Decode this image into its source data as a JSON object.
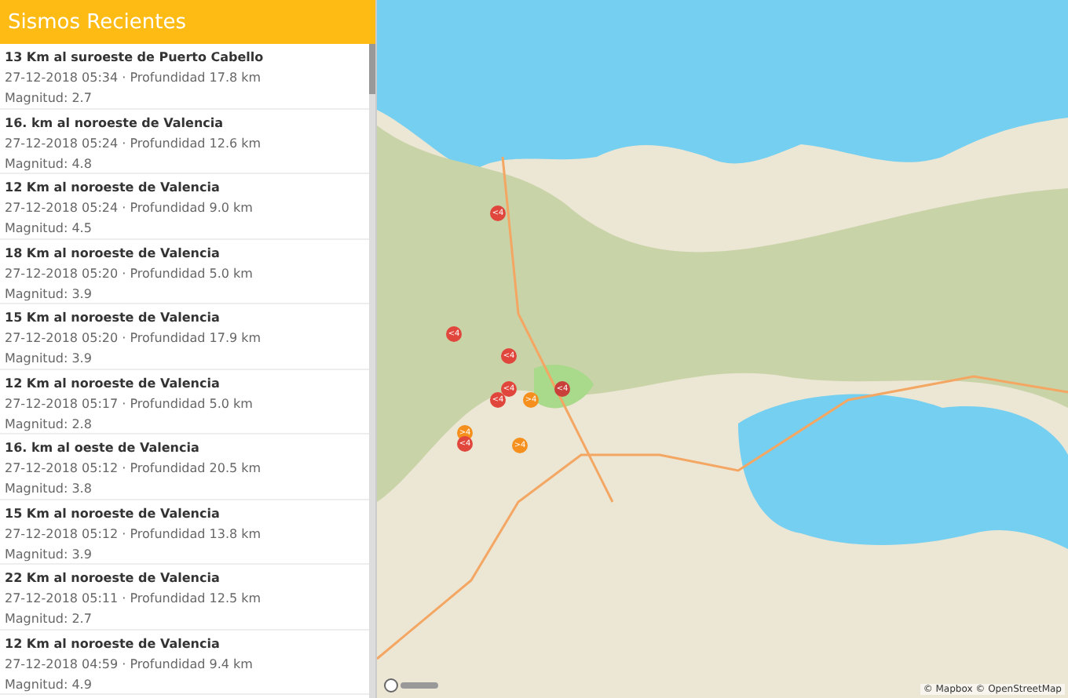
{
  "header": {
    "title": "Sismos Recientes"
  },
  "quakes": [
    {
      "place": "13 Km al suroeste de Puerto Cabello",
      "details": "27-12-2018 05:34 · Profundidad 17.8 km",
      "magnitude": "Magnitud: 2.7"
    },
    {
      "place": "16. km al noroeste de Valencia",
      "details": "27-12-2018 05:24 · Profundidad 12.6 km",
      "magnitude": "Magnitud: 4.8"
    },
    {
      "place": "12 Km al noroeste de Valencia",
      "details": "27-12-2018 05:24 · Profundidad 9.0 km",
      "magnitude": "Magnitud: 4.5"
    },
    {
      "place": "18 Km al noroeste de Valencia",
      "details": "27-12-2018 05:20 · Profundidad 5.0 km",
      "magnitude": "Magnitud: 3.9"
    },
    {
      "place": "15 Km al noroeste de Valencia",
      "details": "27-12-2018 05:20 · Profundidad 17.9 km",
      "magnitude": "Magnitud: 3.9"
    },
    {
      "place": "12 Km al noroeste de Valencia",
      "details": "27-12-2018 05:17 · Profundidad 5.0 km",
      "magnitude": "Magnitud: 2.8"
    },
    {
      "place": "16. km al oeste de Valencia",
      "details": "27-12-2018 05:12 · Profundidad 20.5 km",
      "magnitude": "Magnitud: 3.8"
    },
    {
      "place": "15 Km al noroeste de Valencia",
      "details": "27-12-2018 05:12 · Profundidad 13.8 km",
      "magnitude": "Magnitud: 3.9"
    },
    {
      "place": "22 Km al noroeste de Valencia",
      "details": "27-12-2018 05:11 · Profundidad 12.5 km",
      "magnitude": "Magnitud: 2.7"
    },
    {
      "place": "12 Km al noroeste de Valencia",
      "details": "27-12-2018 04:59 · Profundidad 9.4 km",
      "magnitude": "Magnitud: 4.9"
    }
  ],
  "map": {
    "markers": [
      {
        "label": "<4",
        "color": "#e0463c"
      },
      {
        "label": "<4",
        "color": "#e0463c"
      },
      {
        "label": "<4",
        "color": "#e0463c"
      },
      {
        "label": "<4",
        "color": "#e0463c"
      },
      {
        "label": "<4",
        "color": "#e0463c"
      },
      {
        "label": "<4",
        "color": "#c9403a"
      },
      {
        "label": ">4",
        "color": "#f5901e"
      },
      {
        "label": ">4",
        "color": "#f5901e"
      },
      {
        "label": "<4",
        "color": "#e0463c"
      },
      {
        "label": ">4",
        "color": "#f5901e"
      }
    ],
    "attribution": "© Mapbox © OpenStreetMap"
  }
}
